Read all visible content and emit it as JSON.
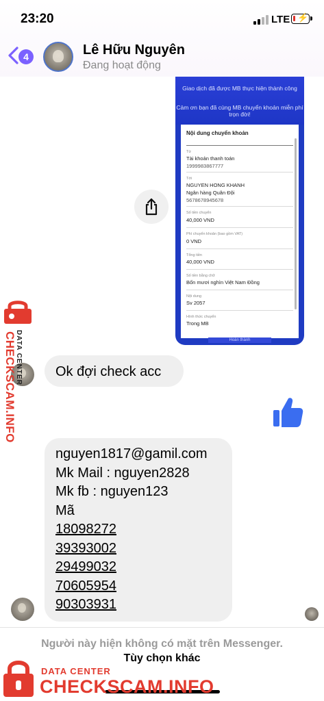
{
  "status_bar": {
    "time": "23:20",
    "network": "LTE"
  },
  "header": {
    "back_badge": "4",
    "contact_name": "Lê Hữu Nguyên",
    "contact_status": "Đang hoạt động"
  },
  "receipt": {
    "message_1": "Giao dịch đã được MB thực hiện thành công",
    "message_2": "Cảm ơn bạn đã cùng MB chuyển khoản miễn phí trọn đời!",
    "title": "Nội dung chuyển khoản",
    "fields": [
      {
        "label": "Từ",
        "values": [
          "Tài khoản thanh toán",
          "1999983867777"
        ]
      },
      {
        "label": "Tới",
        "values": [
          "NGUYEN HONG KHANH",
          "Ngân hàng Quân Đội",
          "5678678945678"
        ]
      },
      {
        "label": "Số tiền chuyển",
        "values": [
          "40,000 VND"
        ]
      },
      {
        "label": "Phí chuyển khoản (bao gồm VAT)",
        "values": [
          "0 VND"
        ]
      },
      {
        "label": "Tổng tiền",
        "values": [
          "40,000 VND"
        ]
      },
      {
        "label": "Số tiền bằng chữ",
        "values": [
          "Bốn mươi nghìn Việt Nam Đồng"
        ]
      },
      {
        "label": "Nội dung",
        "values": [
          "Sv 2057"
        ]
      },
      {
        "label": "Hình thức chuyển",
        "values": [
          "Trong MB"
        ]
      }
    ],
    "button": "Hoàn thành"
  },
  "messages": {
    "bubble_1": "Ok đợi check acc",
    "bubble_2": {
      "lines": [
        "nguyen1817@gamil.com",
        "Mk  Mail : nguyen2828",
        "Mk fb : nguyen123",
        "Mã"
      ],
      "codes": [
        "18098272",
        "39393002",
        "29499032",
        "70605954",
        "90303931"
      ]
    }
  },
  "footer": {
    "unavailable_notice": "Người này hiện không có mặt trên Messenger.",
    "more_options": "Tùy chọn khác"
  },
  "watermark": {
    "vertical_small": "DATA CENTER",
    "vertical_big": "CHECKSCAM.INFO",
    "bottom_small": "DATA CENTER",
    "bottom_big": "CHECKSCAM.INFO"
  },
  "colors": {
    "accent": "#7b61ff",
    "messenger_blue": "#3a6df0",
    "bank_blue": "#1f3bc2",
    "watermark_red": "#e23b2f",
    "bubble_gray": "#efefef"
  },
  "battery_level": 0.15
}
